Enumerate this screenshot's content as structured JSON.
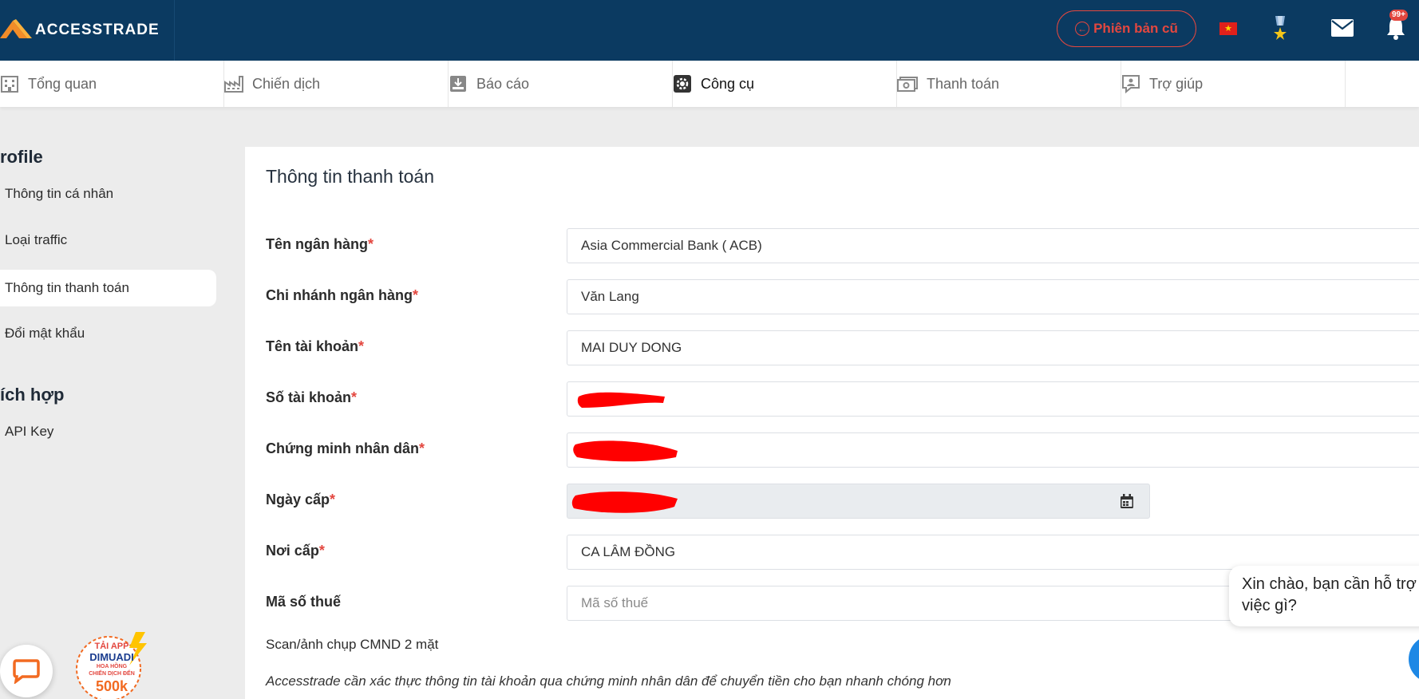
{
  "header": {
    "brand": "ACCESSTRADE",
    "old_version_label": "Phiên bản cũ",
    "notification_badge": "99+"
  },
  "nav": {
    "items": [
      {
        "label": "Tổng quan",
        "icon": "building-icon"
      },
      {
        "label": "Chiến dịch",
        "icon": "factory-icon"
      },
      {
        "label": "Báo cáo",
        "icon": "report-icon"
      },
      {
        "label": "Công cụ",
        "icon": "gear-icon",
        "active": true
      },
      {
        "label": "Thanh toán",
        "icon": "money-icon"
      },
      {
        "label": "Trợ giúp",
        "icon": "support-icon"
      }
    ]
  },
  "sidebar": {
    "profile_heading": "rofile",
    "profile_items": [
      {
        "label": "Thông tin cá nhân"
      },
      {
        "label": "Loại traffic"
      },
      {
        "label": "Thông tin thanh toán",
        "active": true
      },
      {
        "label": "Đổi mật khẩu"
      }
    ],
    "integration_heading": "ích hợp",
    "integration_items": [
      {
        "label": "API Key"
      }
    ]
  },
  "form": {
    "title": "Thông tin thanh toán",
    "required_mark": "*",
    "fields": {
      "bank_name": {
        "label": "Tên ngân hàng",
        "value": "Asia Commercial Bank ( ACB)"
      },
      "bank_branch": {
        "label": "Chi nhánh ngân hàng",
        "value": "Văn Lang"
      },
      "account_name": {
        "label": "Tên tài khoản",
        "value": "MAI DUY DONG"
      },
      "account_number": {
        "label": "Số tài khoản",
        "value": ""
      },
      "id_number": {
        "label": "Chứng minh nhân dân",
        "value": ""
      },
      "issue_date": {
        "label": "Ngày cấp",
        "value": ""
      },
      "issue_place": {
        "label": "Nơi cấp",
        "value": "CA LÂM ĐỒNG"
      },
      "tax_code": {
        "label": "Mã số thuế",
        "value": "",
        "placeholder": "Mã số thuế"
      }
    },
    "scan_label": "Scan/ảnh chụp CMND 2 mặt",
    "note": "Accesstrade cần xác thực thông tin tài khoản qua chứng minh nhân dân để chuyển tiền cho bạn nhanh chóng hơn"
  },
  "chat": {
    "greeting": "Xin chào, bạn cần hỗ trợ việc gì?"
  },
  "promo": {
    "line1": "TẢI APP",
    "line2": "DIMUADI",
    "line3": "HOA HỒNG",
    "line4": "CHIẾN DỊCH ĐẾN",
    "line5": "500k"
  },
  "colors": {
    "header_bg": "#0b3a61",
    "accent_red": "#e3473f",
    "page_bg": "#ececec"
  }
}
